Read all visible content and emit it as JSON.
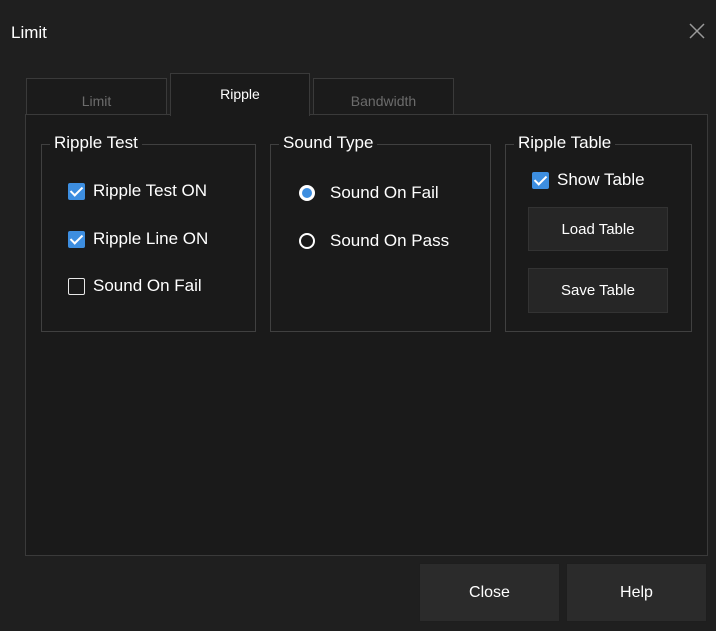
{
  "window": {
    "title": "Limit",
    "close_icon": "close-icon"
  },
  "tabs": [
    {
      "label": "Limit",
      "active": false
    },
    {
      "label": "Ripple",
      "active": true
    },
    {
      "label": "Bandwidth",
      "active": false
    }
  ],
  "ripple_test": {
    "title": "Ripple Test",
    "items": [
      {
        "label": "Ripple Test ON",
        "checked": true
      },
      {
        "label": "Ripple Line ON",
        "checked": true
      },
      {
        "label": "Sound On Fail",
        "checked": false
      }
    ]
  },
  "sound_type": {
    "title": "Sound Type",
    "options": [
      {
        "label": "Sound On Fail",
        "selected": true
      },
      {
        "label": "Sound On Pass",
        "selected": false
      }
    ]
  },
  "ripple_table": {
    "title": "Ripple Table",
    "show_table": {
      "label": "Show Table",
      "checked": true
    },
    "load_label": "Load Table",
    "save_label": "Save Table"
  },
  "footer": {
    "close_label": "Close",
    "help_label": "Help"
  },
  "colors": {
    "accent": "#3d8ee0",
    "background": "#1f1f1f",
    "border": "#3a3a3a"
  }
}
